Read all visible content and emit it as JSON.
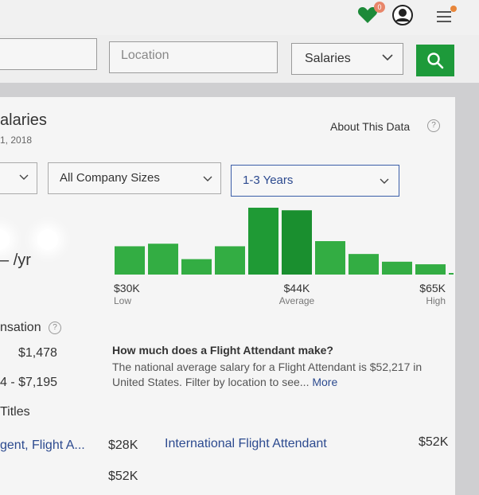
{
  "header": {
    "notification_count": "0",
    "icons": [
      "heart-icon",
      "avatar-icon",
      "hamburger-menu-icon"
    ]
  },
  "search": {
    "location_placeholder": "Location",
    "type_value": "Salaries"
  },
  "page": {
    "title": "alaries",
    "date": "1, 2018",
    "about_label": "About This Data"
  },
  "filters": {
    "company_size": "All Company Sizes",
    "experience": "1-3 Years"
  },
  "salary": {
    "per_year_label": "/yr"
  },
  "chart_data": {
    "type": "bar",
    "values": [
      5.5,
      6,
      3,
      5.5,
      13,
      12.5,
      6.5,
      4,
      2.5,
      2,
      0.3
    ],
    "colors": [
      "#33ad43",
      "#33ad43",
      "#33ad43",
      "#33ad43",
      "#1f9a35",
      "#1a8f2f",
      "#33ad43",
      "#33ad43",
      "#33ad43",
      "#33ad43",
      "#33ad43"
    ],
    "markers": [
      {
        "value": "$30K",
        "label": "Low"
      },
      {
        "value": "$44K",
        "label": "Average"
      },
      {
        "value": "$65K",
        "label": "High"
      }
    ]
  },
  "compensation": {
    "heading": "nsation",
    "value1": "$1,478",
    "value2": "4 - $7,195"
  },
  "titles": {
    "heading": "Titles"
  },
  "info": {
    "question": "How much does a Flight Attendant make?",
    "answer": "The national average salary for a Flight Attendant is $52,217 in United States. Filter by location to see...",
    "more_label": "More"
  },
  "rows": [
    {
      "title": "gent, Flight A...",
      "salary": "$28K"
    },
    {
      "title": "International Flight Attendant",
      "salary": "$52K"
    },
    {
      "salary": "$52K"
    }
  ]
}
